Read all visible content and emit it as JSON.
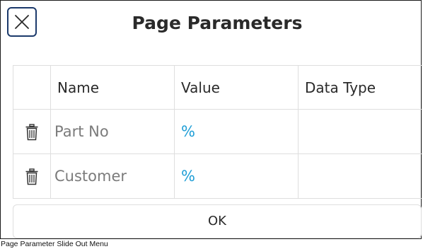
{
  "dialog": {
    "title": "Page Parameters",
    "close_icon": "close-icon"
  },
  "table": {
    "headers": {
      "name": "Name",
      "value": "Value",
      "data_type": "Data Type"
    },
    "rows": [
      {
        "name": "Part No",
        "value": "%",
        "data_type": "",
        "delete_icon": "trash-icon"
      },
      {
        "name": "Customer",
        "value": "%",
        "data_type": "",
        "delete_icon": "trash-icon"
      }
    ]
  },
  "ok_button": {
    "label": "OK"
  },
  "caption": "Page Parameter Slide Out Menu",
  "colors": {
    "close_border": "#1c3a6b",
    "value_text": "#1e9ed6",
    "name_text": "#7b7b7b",
    "grid_line": "#dedede"
  }
}
